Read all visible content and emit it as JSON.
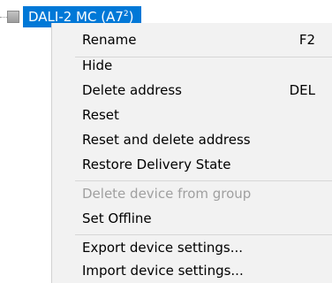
{
  "tree": {
    "selected_node": {
      "label": "DALI-2 MC (A7",
      "sup": "2",
      "suffix": ")"
    }
  },
  "context_menu": {
    "items": [
      {
        "label": "Rename",
        "shortcut": "F2",
        "enabled": true
      },
      {
        "label": "Hide",
        "shortcut": "",
        "enabled": true
      },
      {
        "label": "Delete address",
        "shortcut": "DEL",
        "enabled": true
      },
      {
        "label": "Reset",
        "shortcut": "",
        "enabled": true
      },
      {
        "label": "Reset and delete address",
        "shortcut": "",
        "enabled": true
      },
      {
        "label": "Restore Delivery State",
        "shortcut": "",
        "enabled": true
      },
      {
        "label": "Delete device from group",
        "shortcut": "",
        "enabled": false
      },
      {
        "label": "Set Offline",
        "shortcut": "",
        "enabled": true
      },
      {
        "label": "Export device settings...",
        "shortcut": "",
        "enabled": true
      },
      {
        "label": "Import device settings...",
        "shortcut": "",
        "enabled": true
      }
    ]
  },
  "colors": {
    "selection": "#0078d7",
    "menu_background": "#f2f2f2",
    "disabled_text": "#a0a0a0"
  }
}
